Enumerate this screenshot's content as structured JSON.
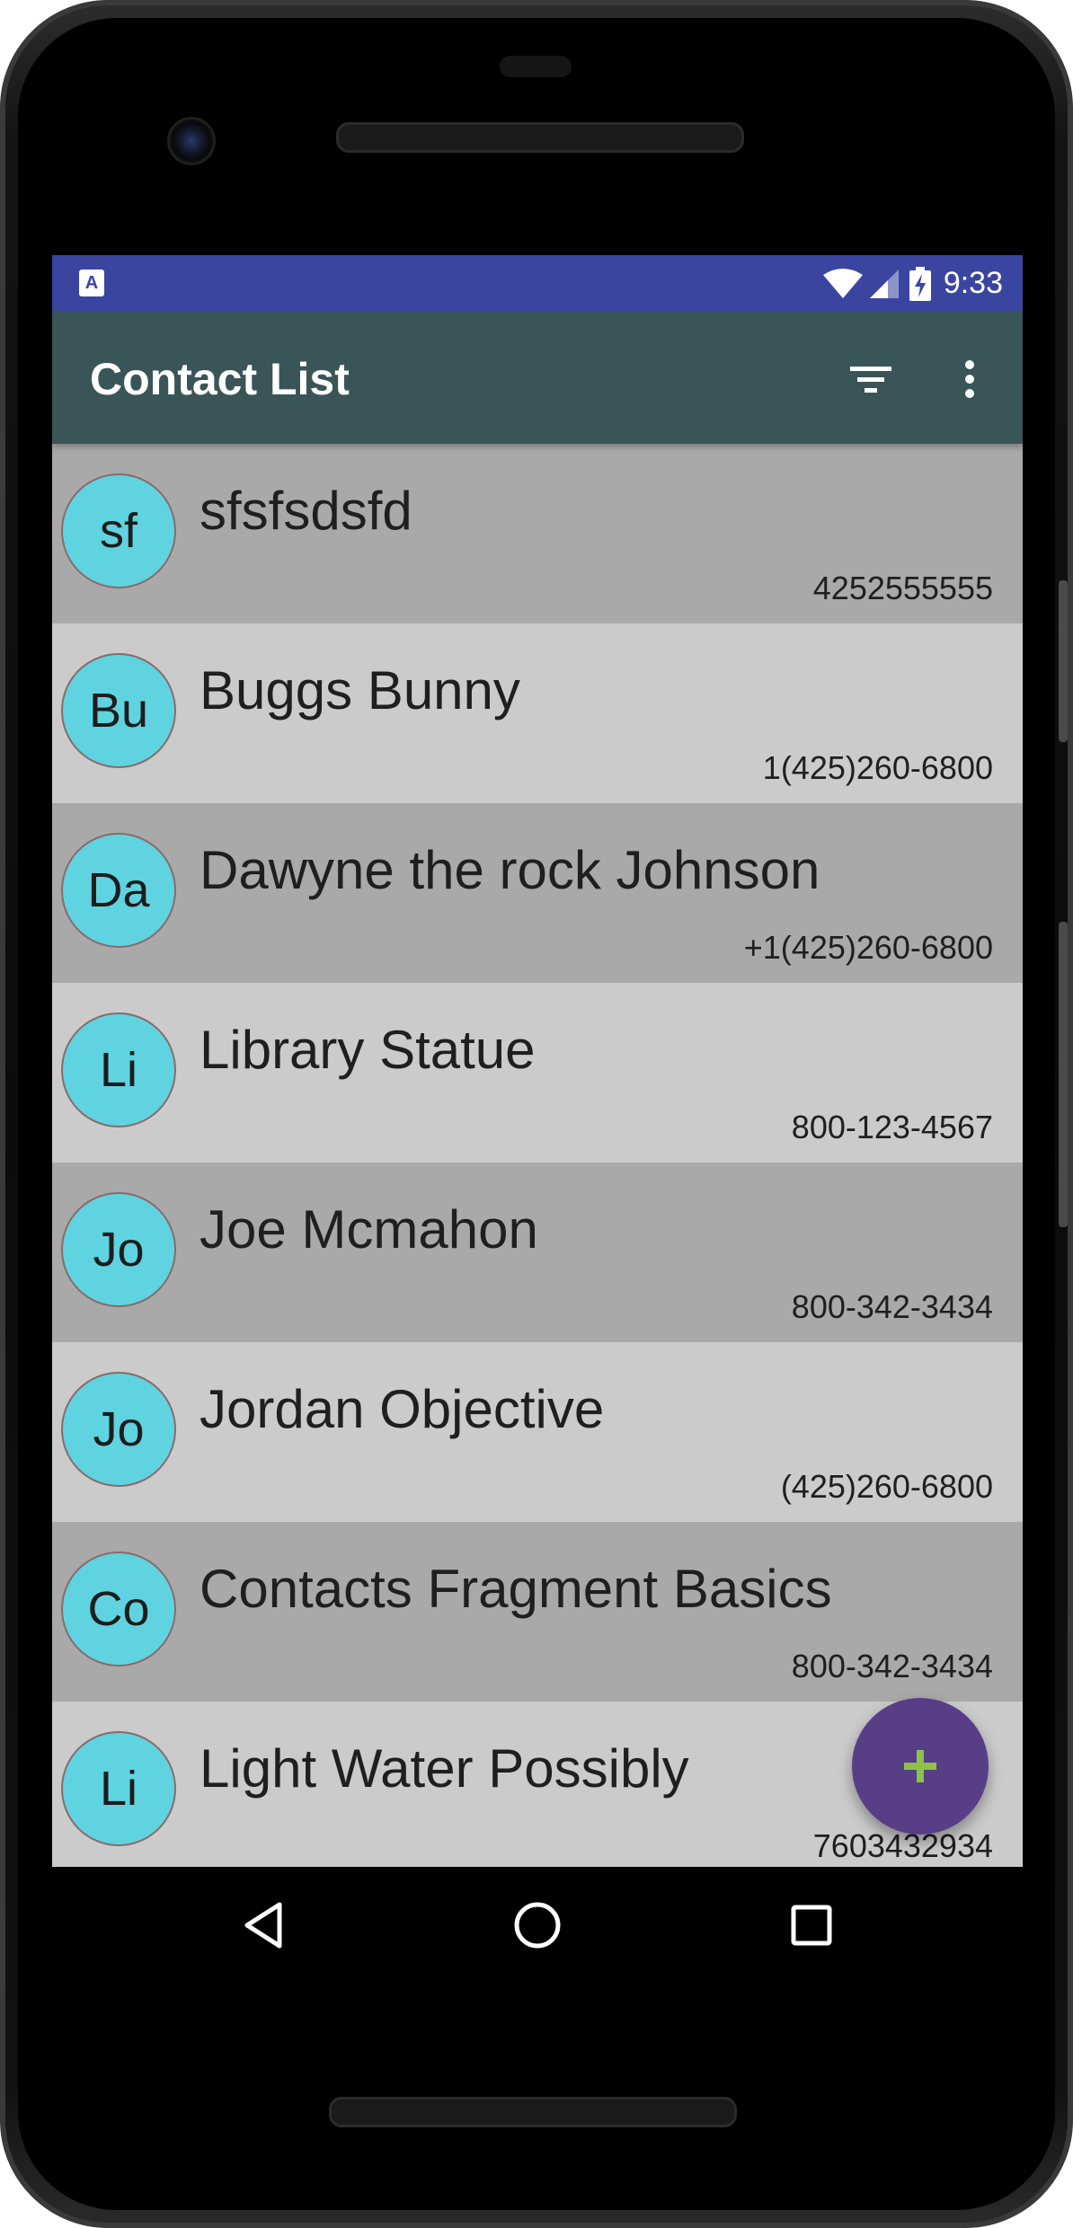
{
  "status_bar": {
    "app_icon": "A",
    "time": "9:33",
    "icons": [
      "wifi-icon",
      "cell-signal-icon",
      "battery-charging-icon"
    ],
    "color": "#3a45a0"
  },
  "toolbar": {
    "title": "Contact List",
    "actions": [
      "filter-icon",
      "more-vert-icon"
    ],
    "color": "#3a5557"
  },
  "contacts": [
    {
      "initials": "sf",
      "name": "sfsfsdsfd",
      "phone": "4252555555"
    },
    {
      "initials": "Bu",
      "name": "Buggs Bunny",
      "phone": "1(425)260-6800"
    },
    {
      "initials": "Da",
      "name": "Dawyne the rock Johnson",
      "phone": "+1(425)260-6800"
    },
    {
      "initials": "Li",
      "name": "Library Statue",
      "phone": "800-123-4567"
    },
    {
      "initials": "Jo",
      "name": "Joe Mcmahon",
      "phone": "800-342-3434"
    },
    {
      "initials": "Jo",
      "name": "Jordan Objective",
      "phone": "(425)260-6800"
    },
    {
      "initials": "Co",
      "name": "Contacts Fragment Basics",
      "phone": "800-342-3434"
    },
    {
      "initials": "Li",
      "name": "Light Water Possibly",
      "phone": "7603432934"
    }
  ],
  "fab": {
    "icon": "plus-icon",
    "color": "#573e87",
    "icon_color": "#8bc34a"
  },
  "colors": {
    "avatar": "#5fd3df",
    "row_dark": "#a9a9a9",
    "row_light": "#cbcbcb"
  },
  "navigation": [
    "back-icon",
    "home-icon",
    "recents-icon"
  ]
}
